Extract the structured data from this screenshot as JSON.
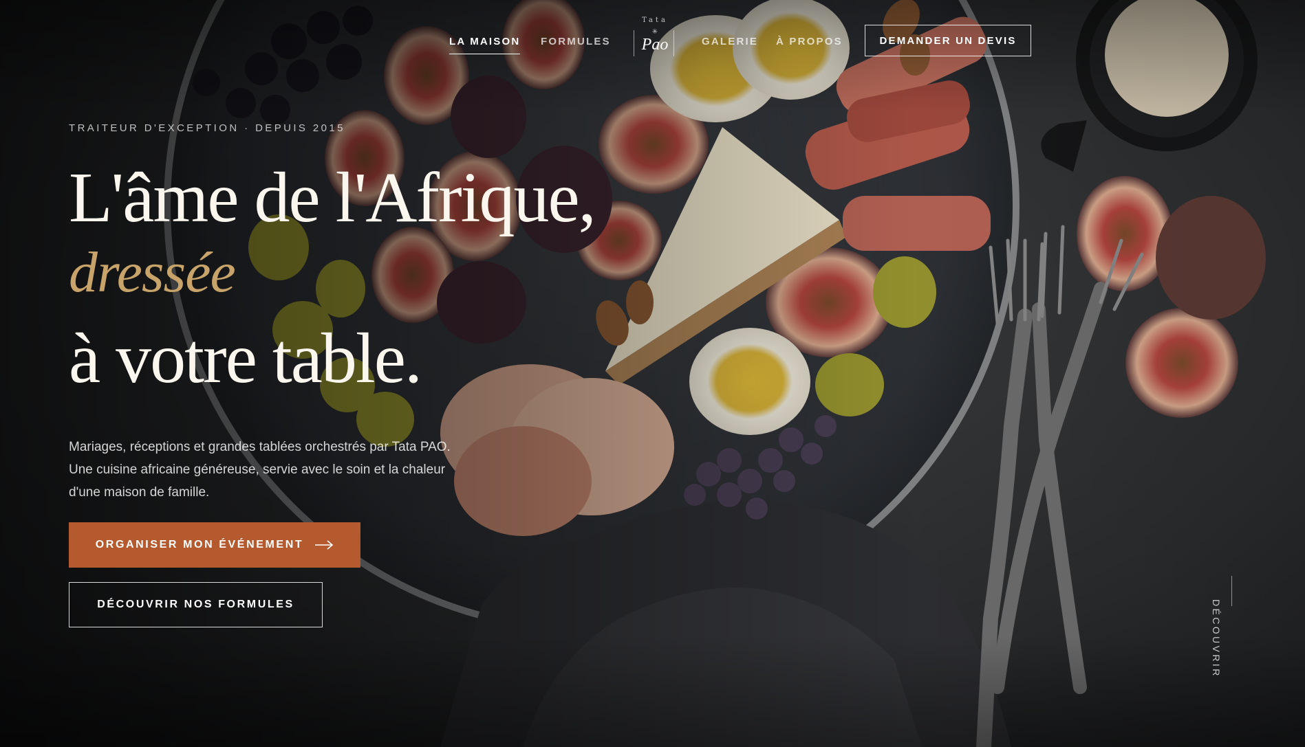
{
  "nav": {
    "items": [
      {
        "label": "LA MAISON",
        "active": true
      },
      {
        "label": "FORMULES",
        "active": false
      },
      {
        "label": "GALERIE",
        "active": false
      },
      {
        "label": "À PROPOS",
        "active": false
      }
    ],
    "logo": {
      "small": "Tata",
      "main": "Pao"
    },
    "quote_button": "DEMANDER UN DEVIS"
  },
  "hero": {
    "eyebrow": "TRAITEUR D'EXCEPTION · DEPUIS 2015",
    "title_line1": "L'âme de l'Afrique,",
    "title_line2": "dressée",
    "title_line3": "à votre table.",
    "lead": "Mariages, réceptions et grandes tablées orchestrés par Tata PAO. Une cuisine africaine généreuse, servie avec le soin et la chaleur d'une maison de famille.",
    "cta_primary": "ORGANISER MON ÉVÉNEMENT",
    "cta_secondary": "DÉCOUVRIR NOS FORMULES",
    "scroll_hint": "DÉCOUVRIR"
  },
  "colors": {
    "accent": "#b5592f",
    "gold": "#c9a46a",
    "background": "#2b2d2f"
  },
  "icons": [
    "arrow-right-icon"
  ]
}
